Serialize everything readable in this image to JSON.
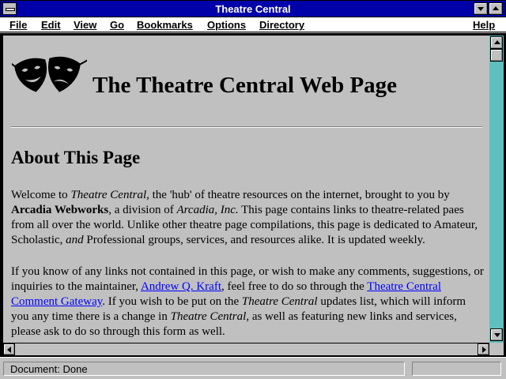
{
  "window": {
    "title": "Theatre Central"
  },
  "menu": {
    "file": "File",
    "edit": "Edit",
    "view": "View",
    "go": "Go",
    "bookmarks": "Bookmarks",
    "options": "Options",
    "directory": "Directory",
    "help": "Help"
  },
  "page": {
    "title": "The Theatre Central Web Page",
    "about_heading": "About This Page",
    "para1": {
      "t1": "Welcome to ",
      "em1": "Theatre Central",
      "t2": ", the 'hub' of theatre resources on the internet, brought to you by ",
      "strong1": "Arcadia Webworks",
      "t3": ", a division of ",
      "em2": "Arcadia, Inc.",
      "t4": " This page contains links to theatre-related paes from all over the world. Unlike other theatre page compilations, this page is dedicated to Amateur, Scholastic, ",
      "em3": "and",
      "t5": " Professional groups, services, and resources alike. It is updated weekly."
    },
    "para2": {
      "t1": "If you know of any links not contained in this page, or wish to make any comments, suggestions, or inquiries to the maintainer, ",
      "link1": "Andrew Q. Kraft",
      "t2": ", feel free to do so through the ",
      "link2": "Theatre Central Comment Gateway",
      "t3": ". If you wish to be put on the ",
      "em1": "Theatre Central",
      "t4": " updates list, which will inform you any time there is a change in ",
      "em2": "Theatre Central",
      "t5": ", as well as featuring new links and services, please ask to do so through this form as well."
    }
  },
  "status": {
    "text": "Document: Done"
  },
  "icons": {
    "system_menu": "system-menu-icon",
    "minimize": "minimize-icon",
    "maximize": "maximize-icon",
    "logo": "theatre-masks-icon"
  },
  "colors": {
    "titlebar": "#0000a8",
    "link": "#0000ff",
    "scroll_track": "#5fbfbf",
    "chrome": "#c0c0c0"
  }
}
